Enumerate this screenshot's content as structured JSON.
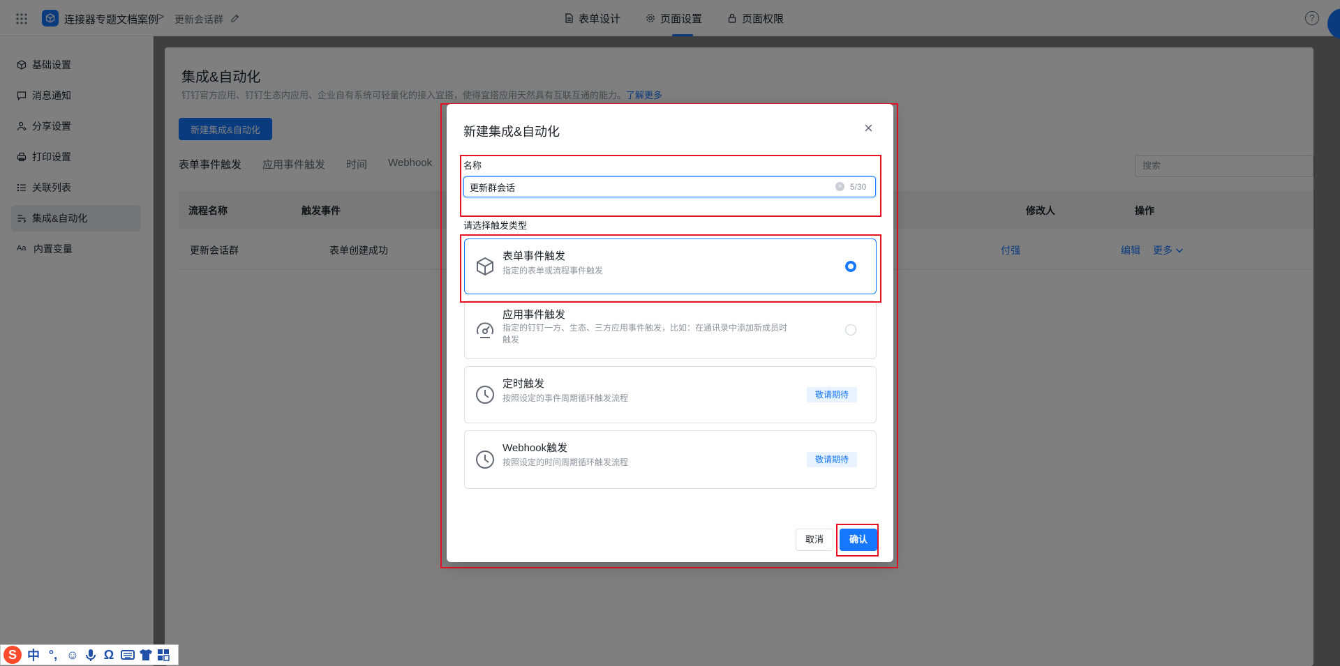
{
  "topbar": {
    "app_name": "连接器专题文档案例",
    "separator": ">",
    "form_name": "更新会话群",
    "nav": [
      {
        "label": "表单设计",
        "icon": "document-icon"
      },
      {
        "label": "页面设置",
        "icon": "gear-icon",
        "active": true
      },
      {
        "label": "页面权限",
        "icon": "lock-icon"
      }
    ],
    "help_symbol": "?"
  },
  "sidebar": {
    "items": [
      {
        "label": "基础设置",
        "icon": "cube-icon"
      },
      {
        "label": "消息通知",
        "icon": "message-icon"
      },
      {
        "label": "分享设置",
        "icon": "share-icon"
      },
      {
        "label": "打印设置",
        "icon": "printer-icon"
      },
      {
        "label": "关联列表",
        "icon": "list-icon"
      },
      {
        "label": "集成&自动化",
        "icon": "flow-icon",
        "active": true
      },
      {
        "label": "内置变量",
        "icon": "variable-icon"
      }
    ],
    "variable_icon_text": "Aa"
  },
  "main": {
    "title": "集成&自动化",
    "description": "钉钉官方应用、钉钉生态内应用、企业自有系统可轻量化的接入宜搭，使得宜搭应用天然具有互联互通的能力。",
    "learn_more": "了解更多",
    "new_button": "新建集成&自动化",
    "tabs": [
      "表单事件触发",
      "应用事件触发",
      "时间",
      "Webhook"
    ],
    "search_placeholder": "搜索",
    "table": {
      "headers": [
        "流程名称",
        "触发事件",
        "修改人",
        "操作"
      ],
      "row": {
        "name": "更新会话群",
        "event": "表单创建成功",
        "modifier": "付强",
        "edit": "编辑",
        "more": "更多"
      }
    }
  },
  "modal": {
    "title": "新建集成&自动化",
    "close_symbol": "×",
    "name_label": "名称",
    "name_value": "更新群会话",
    "counter": "5/30",
    "trigger_label": "请选择触发类型",
    "options": [
      {
        "title": "表单事件触发",
        "desc": "指定的表单或流程事件触发",
        "icon": "cube-icon",
        "selected": true
      },
      {
        "title": "应用事件触发",
        "desc": "指定的钉钉一方、生态、三方应用事件触发，比如：在通讯录中添加新成员时触发",
        "icon": "gauge-icon",
        "selected": false
      },
      {
        "title": "定时触发",
        "desc": "按照设定的事件周期循环触发流程",
        "icon": "clock-icon",
        "badge": "敬请期待"
      },
      {
        "title": "Webhook触发",
        "desc": "按照设定的时间周期循环触发流程",
        "icon": "clock-icon",
        "badge": "敬请期待"
      }
    ],
    "cancel": "取消",
    "confirm": "确认"
  },
  "ime": {
    "logo": "S",
    "mode": "中",
    "punct": "°,",
    "omega": "Ω"
  },
  "colors": {
    "accent": "#1677ff",
    "highlight": "#e81123",
    "overlay": "rgba(0,0,0,0.5)"
  }
}
